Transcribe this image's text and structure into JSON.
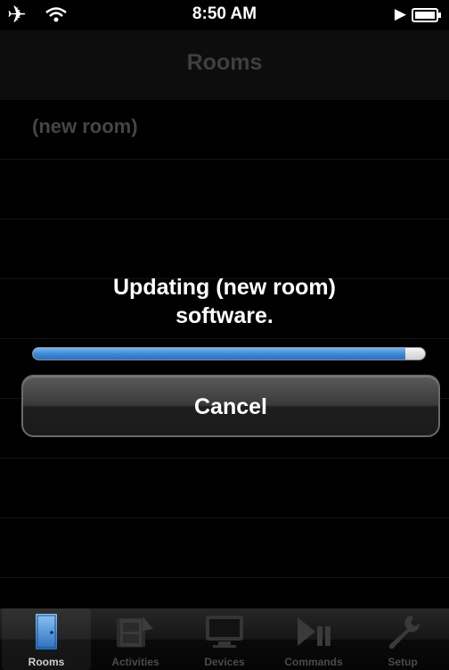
{
  "status_bar": {
    "time": "8:50 AM"
  },
  "nav_bar": {
    "title": "Rooms"
  },
  "rooms": [
    {
      "label": "(new room)"
    }
  ],
  "progress": {
    "message_line1": "Updating (new room)",
    "message_line2": "software.",
    "fraction": 0.95
  },
  "cancel_button": {
    "label": "Cancel"
  },
  "tab_bar": {
    "tabs": [
      {
        "label": "Rooms",
        "icon": "door-icon",
        "active": true
      },
      {
        "label": "Activities",
        "icon": "film-icon",
        "active": false
      },
      {
        "label": "Devices",
        "icon": "monitor-icon",
        "active": false
      },
      {
        "label": "Commands",
        "icon": "play-pause-icon",
        "active": false
      },
      {
        "label": "Setup",
        "icon": "wrench-icon",
        "active": false
      }
    ]
  },
  "colors": {
    "progress_fill": "#3b86d6",
    "active_tab_icon": "#3f8fd8"
  }
}
